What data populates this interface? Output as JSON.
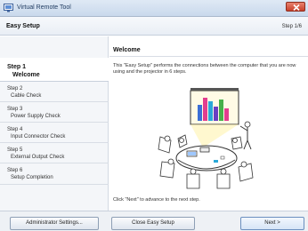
{
  "window": {
    "title": "Virtual Remote Tool",
    "icon": "app-window-icon",
    "close_icon": "close-icon"
  },
  "header": {
    "title": "Easy Setup",
    "step_counter": "Step  1/6"
  },
  "sidebar": {
    "steps": [
      {
        "num": "Step 1",
        "name": "Welcome",
        "active": true
      },
      {
        "num": "Step 2",
        "name": "Cable Check",
        "active": false
      },
      {
        "num": "Step 3",
        "name": "Power Supply Check",
        "active": false
      },
      {
        "num": "Step 4",
        "name": "Input Connector Check",
        "active": false
      },
      {
        "num": "Step 5",
        "name": "External Output Check",
        "active": false
      },
      {
        "num": "Step 6",
        "name": "Setup Completion",
        "active": false
      }
    ]
  },
  "main": {
    "title": "Welcome",
    "description": "This \"Easy Setup\" performs the connections between the computer that you are now using and the projector in 6 steps.",
    "illustration": "meeting-room-projector-illustration",
    "hint": "Click \"Next\" to advance to the next step."
  },
  "footer": {
    "admin_label": "Administrator Settings...",
    "close_label": "Close Easy Setup",
    "next_label": "Next >"
  },
  "colors": {
    "titlebar": "#c9d9ec",
    "close_button": "#c8412b",
    "sidebar_bg": "#f4f6f9",
    "screen_bar_palette": [
      "#3b6fd6",
      "#e23d8f",
      "#2aa8d8",
      "#6a3fc2",
      "#47b04a"
    ]
  }
}
